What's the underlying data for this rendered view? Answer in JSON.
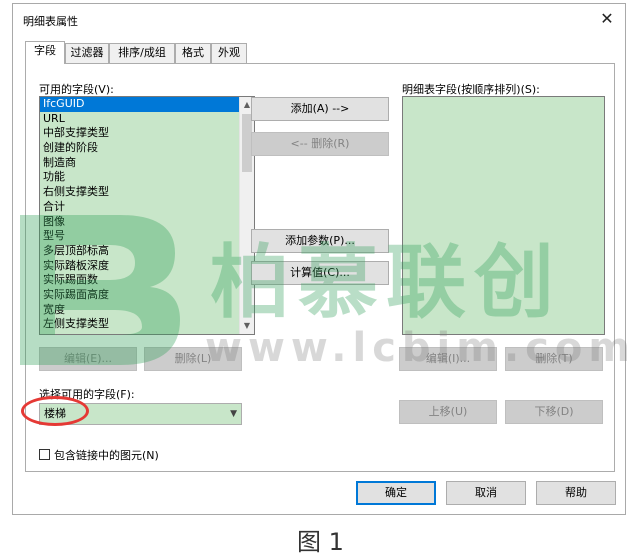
{
  "dialog": {
    "title": "明细表属性",
    "close_glyph": "✕"
  },
  "tabs": [
    {
      "label": "字段",
      "active": true
    },
    {
      "label": "过滤器",
      "active": false
    },
    {
      "label": "排序/成组",
      "active": false
    },
    {
      "label": "格式",
      "active": false
    },
    {
      "label": "外观",
      "active": false
    }
  ],
  "available": {
    "label": "可用的字段(V):",
    "items": [
      "IfcGUID",
      "URL",
      "中部支撑类型",
      "创建的阶段",
      "制造商",
      "功能",
      "右侧支撑类型",
      "合计",
      "图像",
      "型号",
      "多层顶部标高",
      "实际踏板深度",
      "实际踢面数",
      "实际踢面高度",
      "宽度",
      "左侧支撑类型"
    ],
    "selected_index": 0
  },
  "scheduled": {
    "label": "明细表字段(按顺序排列)(S):",
    "items": []
  },
  "middle_buttons": {
    "add": "添加(A) -->",
    "remove": "<-- 删除(R)",
    "add_param": "添加参数(P)...",
    "calc_value": "计算值(C)..."
  },
  "left_buttons": {
    "edit": "编辑(E)...",
    "delete": "删除(L)"
  },
  "right_buttons": {
    "edit": "编辑(I)...",
    "delete": "删除(T)",
    "move_up": "上移(U)",
    "move_down": "下移(D)"
  },
  "select_field": {
    "label": "选择可用的字段(F):",
    "value": "楼梯"
  },
  "include_linked": {
    "label": "包含链接中的图元(N)",
    "checked": false
  },
  "footer": {
    "ok": "确定",
    "cancel": "取消",
    "help": "帮助"
  },
  "watermark": {
    "brand": "柏慕联创",
    "url": "www.lcbim.com"
  },
  "caption": "图 1",
  "colors": {
    "list_bg": "#c8e6c9",
    "selection": "#0078d7",
    "annotation_red": "#e53935",
    "watermark_green": "#2e9e57"
  }
}
